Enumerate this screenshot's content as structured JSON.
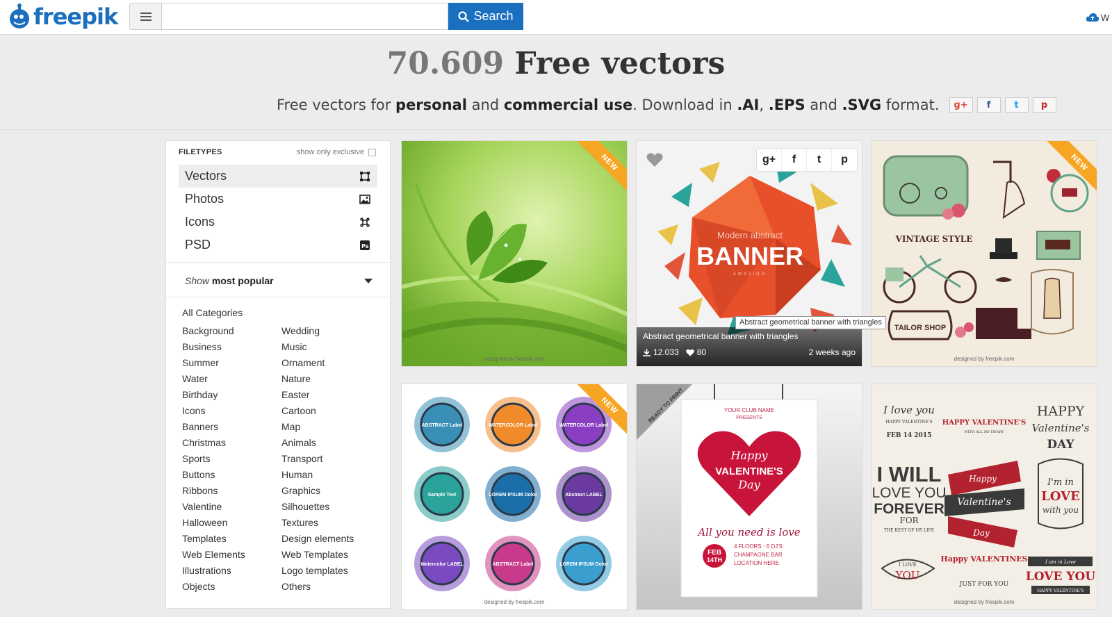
{
  "header": {
    "logo_text": "freepik",
    "search_placeholder": "",
    "search_value": "",
    "search_button": "Search",
    "upload_label": "W"
  },
  "hero": {
    "count": "70.609",
    "title_rest": "Free vectors",
    "sub_1": "Free vectors for",
    "sub_b1": "personal",
    "sub_2": "and",
    "sub_b2": "commercial use",
    "sub_3": ". Download in",
    "sub_b3": ".AI",
    "sub_4": ",",
    "sub_b4": ".EPS",
    "sub_5": "and",
    "sub_b5": ".SVG",
    "sub_6": "format.",
    "share": [
      {
        "icon": "google-plus-icon",
        "glyph": "g+",
        "color": "#dd4b39"
      },
      {
        "icon": "facebook-icon",
        "glyph": "f",
        "color": "#3b5998"
      },
      {
        "icon": "twitter-icon",
        "glyph": "t",
        "color": "#1da1f2"
      },
      {
        "icon": "pinterest-icon",
        "glyph": "p",
        "color": "#cb2027"
      }
    ]
  },
  "sidebar": {
    "filetypes_heading": "FILETYPES",
    "exclusive_label": "show only exclusive",
    "filetypes": [
      {
        "label": "Vectors",
        "icon": "vector-icon",
        "active": true
      },
      {
        "label": "Photos",
        "icon": "photo-icon",
        "active": false
      },
      {
        "label": "Icons",
        "icon": "command-icon",
        "active": false
      },
      {
        "label": "PSD",
        "icon": "photoshop-icon",
        "active": false
      }
    ],
    "sort_show": "Show",
    "sort_value": "most popular",
    "all_categories": "All Categories",
    "categories_col1": [
      "Background",
      "Business",
      "Summer",
      "Water",
      "Birthday",
      "Icons",
      "Banners",
      "Christmas",
      "Sports",
      "Buttons",
      "Ribbons",
      "Valentine",
      "Halloween",
      "Templates",
      "Web Elements",
      "Illustrations",
      "Objects"
    ],
    "categories_col2": [
      "Wedding",
      "Music",
      "Ornament",
      "Nature",
      "Easter",
      "Cartoon",
      "Map",
      "Animals",
      "Transport",
      "Human",
      "Graphics",
      "Silhouettes",
      "Textures",
      "Design elements",
      "Web Templates",
      "Logo templates",
      "Others"
    ]
  },
  "cards": {
    "new_badge": "NEW",
    "credit": "designed by freepik.com",
    "card2": {
      "title": "Abstract geometrical banner with triangles",
      "downloads": "12.033",
      "likes": "80",
      "time": "2 weeks ago",
      "banner_small": "Modern abstract",
      "banner_big": "BANNER",
      "banner_tiny": "AMAZING",
      "tooltip": "Abstract geometrical banner with triangles",
      "share_glyphs": [
        "g+",
        "f",
        "t",
        "p"
      ]
    },
    "card3": {
      "vintage_label": "VINTAGE STYLE",
      "tailor_label": "TAILOR SHOP"
    },
    "card4": {
      "badges": [
        "ABSTRACT Label",
        "WATERCOLOR Label",
        "WATERCOLOR Label",
        "Sample Text",
        "LOREM IPSUM Dolor",
        "Abstract LABEL",
        "Watercolor LABEL",
        "ABSTRACT Label",
        "LOREM IPSUM Dolor"
      ]
    },
    "card5": {
      "corner": "READY TO PRINT",
      "club": "YOUR CLUB NAME",
      "presents": "PRESENTS",
      "happy": "Happy",
      "valentines": "VALENTINE'S",
      "day": "Day",
      "tagline": "All you need is love",
      "month": "FEB",
      "date": "14TH",
      "details": [
        "4 FLOORS · 6 DJ'S",
        "CHAMPAGNE BAR",
        "LOCATION HERE"
      ]
    },
    "card6": {
      "love_you": "I love you",
      "hv_small": "HAPPY VALENTINE'S",
      "feb": "FEB 14 2015",
      "hv_header": "HAPPY VALENTINE'S",
      "with_all": "WITH ALL MY HEART",
      "happy_big": "HAPPY",
      "valentines_script": "Valentine's",
      "day_big": "DAY",
      "will": "I WILL",
      "love": "LOVE YOU",
      "forever": "FOREVER",
      "for": "FOR",
      "rest": "THE REST OF MY LIFE",
      "ribbon_happy": "Happy",
      "ribbon_val": "Valentine's",
      "ribbon_day": "Day",
      "im_in": "I'm in",
      "love_cap": "LOVE",
      "with_you": "with you",
      "i_love": "I LOVE",
      "you": "YOU",
      "happy_valentines": "Happy VALENTINES",
      "just_for_you": "JUST FOR YOU",
      "i_am_in_love": "I am in Love",
      "loveyou2": "LOVE YOU",
      "happy_val_small": "HAPPY VALENTINE'S"
    }
  }
}
